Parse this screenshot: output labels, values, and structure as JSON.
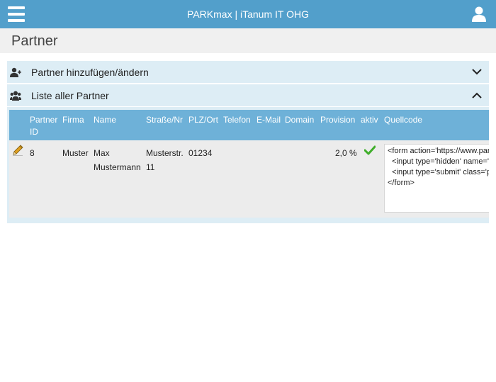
{
  "app": {
    "title": "PARKmax | iTanum IT OHG"
  },
  "page": {
    "title": "Partner"
  },
  "panels": [
    {
      "label": "Partner hinzufügen/ändern",
      "icon": "user-plus-icon",
      "state": "collapsed"
    },
    {
      "label": "Liste aller Partner",
      "icon": "users-icon",
      "state": "expanded"
    }
  ],
  "table": {
    "headers": {
      "id": [
        "Partner",
        "ID"
      ],
      "firma": "Firma",
      "name": "Name",
      "strasse": "Straße/Nr",
      "plz": "PLZ/Ort",
      "telefon": "Telefon",
      "email": "E-Mail",
      "domain": "Domain",
      "provision": "Provision",
      "aktiv": "aktiv",
      "quellcode": "Quellcode"
    },
    "rows": [
      {
        "id": "8",
        "firma": "Muster",
        "name": [
          "Max",
          "Mustermann"
        ],
        "strasse": [
          "Musterstr.",
          "11"
        ],
        "plz": "01234",
        "telefon": "",
        "email": "",
        "domain": "",
        "provision": "2,0 %",
        "aktiv": true,
        "quellcode": "<form action='https://www.parkmax.de/' target='_blank'>\n  <input type='hidden' name='partner' value='8'>\n  <input type='submit' class='parkmax-button' value='Parken'>\n</form>"
      }
    ]
  },
  "colors": {
    "topbar": "#529fcb",
    "table_header": "#6eb1d8",
    "panel": "#ddedf5",
    "row": "#ececec",
    "check": "#3fae2a",
    "edit": "#e0a020"
  }
}
